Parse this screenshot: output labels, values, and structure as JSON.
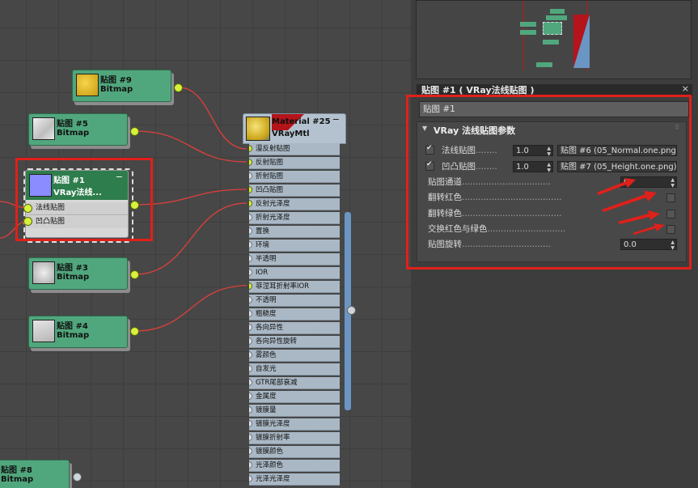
{
  "nodes": {
    "n9": {
      "title": "贴图 #9",
      "sub": "Bitmap"
    },
    "n5": {
      "title": "贴图 #5",
      "sub": "Bitmap"
    },
    "n1": {
      "title": "贴图 #1",
      "sub": "VRay法线...",
      "slot1": "法线贴图",
      "slot2": "凹凸贴图"
    },
    "n3": {
      "title": "贴图 #3",
      "sub": "Bitmap"
    },
    "n4": {
      "title": "贴图 #4",
      "sub": "Bitmap"
    },
    "n8": {
      "title": "贴图 #8",
      "sub": "Bitmap"
    }
  },
  "material": {
    "title": "Material #25",
    "sub": "VRayMtl",
    "slots": [
      "漫反射贴图",
      "反射贴图",
      "折射贴图",
      "凹凸贴图",
      "反射光泽度",
      "折射光泽度",
      "置换",
      "环境",
      "半透明",
      "IOR",
      "菲涅耳折射率IOR",
      "不透明",
      "粗糙度",
      "各向异性",
      "各向异性旋转",
      "雾颜色",
      "自发光",
      "GTR尾部衰减",
      "金属度",
      "镀膜量",
      "镀膜光泽度",
      "镀膜折射率",
      "镀膜颜色",
      "光泽颜色",
      "光泽光泽度"
    ],
    "connected": [
      true,
      true,
      false,
      true,
      true,
      false,
      false,
      false,
      false,
      false,
      true,
      false,
      false,
      false,
      false,
      false,
      false,
      false,
      false,
      false,
      false,
      false,
      false,
      false,
      false
    ]
  },
  "panel": {
    "header": "贴图 #1  ( VRay法线贴图 )",
    "close": "×",
    "name_field": "贴图 #1",
    "rollout_title": "VRay 法线贴图参数",
    "normal_label": "法线贴图",
    "normal_value": "1.0",
    "normal_map": "贴图 #6 (05_Normal.one.png)",
    "bump_label": "凹凸贴图",
    "bump_value": "1.0",
    "bump_map": "贴图 #7 (05_Height.one.png)",
    "channel_label": "贴图通道",
    "channel_value": "0",
    "flip_red_label": "翻转红色",
    "flip_green_label": "翻转绿色",
    "swap_label": "交换红色与绿色",
    "rotation_label": "贴图旋转",
    "rotation_value": "0.0"
  },
  "colors": {
    "accent_red": "#e0201a",
    "node_green": "#51a77d",
    "port_yellow": "#d8f13a",
    "wire_red": "#e0403a"
  }
}
